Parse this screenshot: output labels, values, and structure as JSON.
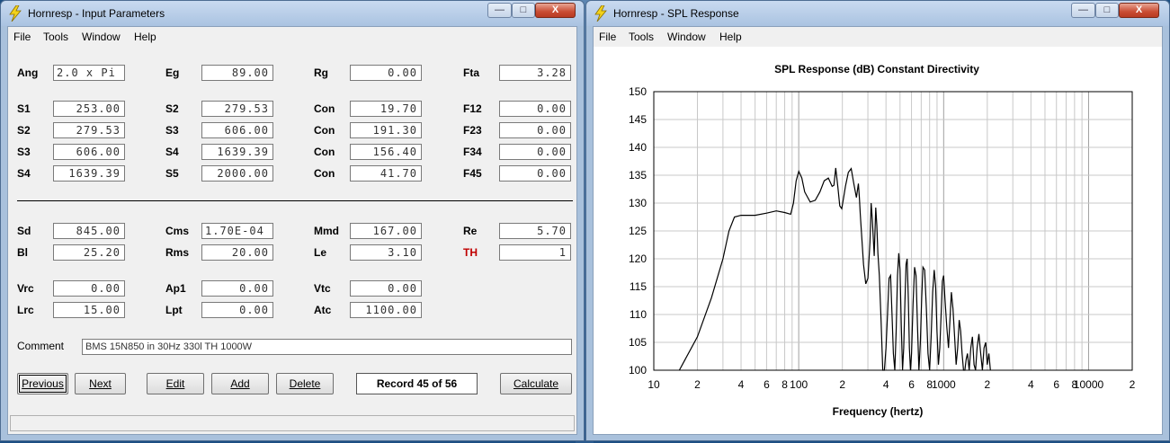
{
  "left_window": {
    "title": "Hornresp - Input Parameters",
    "menu": [
      "File",
      "Tools",
      "Window",
      "Help"
    ],
    "controls": {
      "minimize": "—",
      "maximize": "□",
      "close": "X"
    },
    "params_top": [
      {
        "l1": "Ang",
        "v1": "2.0 x Pi",
        "l2": "Eg",
        "v2": "89.00",
        "l3": "Rg",
        "v3": "0.00",
        "l4": "Fta",
        "v4": "3.28"
      }
    ],
    "params_horn": [
      {
        "l1": "S1",
        "v1": "253.00",
        "l2": "S2",
        "v2": "279.53",
        "l3": "Con",
        "v3": "19.70",
        "l4": "F12",
        "v4": "0.00"
      },
      {
        "l1": "S2",
        "v1": "279.53",
        "l2": "S3",
        "v2": "606.00",
        "l3": "Con",
        "v3": "191.30",
        "l4": "F23",
        "v4": "0.00"
      },
      {
        "l1": "S3",
        "v1": "606.00",
        "l2": "S4",
        "v2": "1639.39",
        "l3": "Con",
        "v3": "156.40",
        "l4": "F34",
        "v4": "0.00"
      },
      {
        "l1": "S4",
        "v1": "1639.39",
        "l2": "S5",
        "v2": "2000.00",
        "l3": "Con",
        "v3": "41.70",
        "l4": "F45",
        "v4": "0.00"
      }
    ],
    "params_driver": [
      {
        "l1": "Sd",
        "v1": "845.00",
        "l2": "Cms",
        "v2": "1.70E-04",
        "l3": "Mmd",
        "v3": "167.00",
        "l4": "Re",
        "v4": "5.70"
      },
      {
        "l1": "Bl",
        "v1": "25.20",
        "l2": "Rms",
        "v2": "20.00",
        "l3": "Le",
        "v3": "3.10",
        "l4": "TH",
        "v4": "1"
      }
    ],
    "params_chamber": [
      {
        "l1": "Vrc",
        "v1": "0.00",
        "l2": "Ap1",
        "v2": "0.00",
        "l3": "Vtc",
        "v3": "0.00"
      },
      {
        "l1": "Lrc",
        "v1": "15.00",
        "l2": "Lpt",
        "v2": "0.00",
        "l3": "Atc",
        "v3": "1100.00"
      }
    ],
    "comment_label": "Comment",
    "comment_value": "BMS 15N850 in 30Hz 330l TH 1000W",
    "buttons": {
      "previous": "Previous",
      "next": "Next",
      "edit": "Edit",
      "add": "Add",
      "delete": "Delete",
      "calculate": "Calculate"
    },
    "record": "Record 45 of 56",
    "th_color": "#c00000"
  },
  "right_window": {
    "title": "Hornresp - SPL Response",
    "menu": [
      "File",
      "Tools",
      "Window",
      "Help"
    ],
    "controls": {
      "minimize": "—",
      "maximize": "□",
      "close": "X"
    }
  },
  "chart_data": {
    "type": "line",
    "title": "SPL Response (dB)   Constant Directivity",
    "xlabel": "Frequency (hertz)",
    "ylabel": "",
    "x_scale": "log",
    "xlim": [
      10,
      20000
    ],
    "ylim": [
      100,
      150
    ],
    "y_ticks": [
      100,
      105,
      110,
      115,
      120,
      125,
      130,
      135,
      140,
      145,
      150
    ],
    "x_tick_labels": [
      {
        "x": 10,
        "label": "10"
      },
      {
        "x": 20,
        "label": "2"
      },
      {
        "x": 40,
        "label": "4"
      },
      {
        "x": 60,
        "label": "6"
      },
      {
        "x": 80,
        "label": "8"
      },
      {
        "x": 100,
        "label": "100"
      },
      {
        "x": 200,
        "label": "2"
      },
      {
        "x": 400,
        "label": "4"
      },
      {
        "x": 600,
        "label": "6"
      },
      {
        "x": 800,
        "label": "8"
      },
      {
        "x": 1000,
        "label": "1000"
      },
      {
        "x": 2000,
        "label": "2"
      },
      {
        "x": 4000,
        "label": "4"
      },
      {
        "x": 6000,
        "label": "6"
      },
      {
        "x": 8000,
        "label": "8"
      },
      {
        "x": 10000,
        "label": "10000"
      },
      {
        "x": 20000,
        "label": "2"
      }
    ],
    "grid": true,
    "line_color": "#000000",
    "grid_color": "#c8c8c8",
    "series": [
      {
        "points": [
          [
            15,
            100
          ],
          [
            20,
            106
          ],
          [
            25,
            113
          ],
          [
            30,
            120
          ],
          [
            33,
            125
          ],
          [
            36,
            127.5
          ],
          [
            40,
            127.8
          ],
          [
            50,
            127.8
          ],
          [
            60,
            128.2
          ],
          [
            70,
            128.6
          ],
          [
            80,
            128.3
          ],
          [
            88,
            128
          ],
          [
            92,
            130
          ],
          [
            96,
            134
          ],
          [
            100,
            135.7
          ],
          [
            105,
            134.5
          ],
          [
            110,
            132
          ],
          [
            120,
            130.2
          ],
          [
            130,
            130.5
          ],
          [
            140,
            132
          ],
          [
            150,
            134
          ],
          [
            160,
            134.5
          ],
          [
            170,
            133
          ],
          [
            175,
            133.2
          ],
          [
            180,
            136.3
          ],
          [
            186,
            133
          ],
          [
            192,
            129.5
          ],
          [
            198,
            129
          ],
          [
            204,
            131
          ],
          [
            210,
            133
          ],
          [
            220,
            135.5
          ],
          [
            230,
            136.2
          ],
          [
            240,
            133.5
          ],
          [
            250,
            131
          ],
          [
            258,
            133.5
          ],
          [
            262,
            131
          ],
          [
            266,
            128
          ],
          [
            272,
            124
          ],
          [
            280,
            119
          ],
          [
            290,
            115.5
          ],
          [
            300,
            116.5
          ],
          [
            310,
            123
          ],
          [
            316,
            130
          ],
          [
            322,
            127
          ],
          [
            328,
            123
          ],
          [
            332,
            120.5
          ],
          [
            340,
            129.2
          ],
          [
            346,
            126
          ],
          [
            352,
            121
          ],
          [
            360,
            117
          ],
          [
            370,
            109
          ],
          [
            380,
            100
          ],
          [
            390,
            100
          ],
          [
            400,
            104
          ],
          [
            410,
            110
          ],
          [
            420,
            116.5
          ],
          [
            430,
            117
          ],
          [
            440,
            110
          ],
          [
            450,
            103
          ],
          [
            460,
            100
          ],
          [
            470,
            107
          ],
          [
            480,
            117
          ],
          [
            490,
            121
          ],
          [
            500,
            118
          ],
          [
            510,
            108
          ],
          [
            520,
            100
          ],
          [
            530,
            104
          ],
          [
            540,
            112
          ],
          [
            550,
            119
          ],
          [
            560,
            120
          ],
          [
            570,
            113
          ],
          [
            580,
            104
          ],
          [
            590,
            100
          ],
          [
            600,
            103
          ],
          [
            615,
            112
          ],
          [
            630,
            118.5
          ],
          [
            645,
            117
          ],
          [
            660,
            108
          ],
          [
            675,
            100
          ],
          [
            690,
            105
          ],
          [
            705,
            113
          ],
          [
            720,
            118.5
          ],
          [
            740,
            118
          ],
          [
            760,
            111
          ],
          [
            780,
            103
          ],
          [
            800,
            100
          ],
          [
            820,
            106
          ],
          [
            840,
            114
          ],
          [
            860,
            118
          ],
          [
            880,
            115
          ],
          [
            900,
            107
          ],
          [
            920,
            101
          ],
          [
            940,
            104
          ],
          [
            960,
            110
          ],
          [
            980,
            116
          ],
          [
            1000,
            117
          ],
          [
            1020,
            113
          ],
          [
            1050,
            108
          ],
          [
            1080,
            104
          ],
          [
            1100,
            108
          ],
          [
            1130,
            114
          ],
          [
            1160,
            111
          ],
          [
            1190,
            106
          ],
          [
            1220,
            101
          ],
          [
            1250,
            104
          ],
          [
            1280,
            109
          ],
          [
            1310,
            107
          ],
          [
            1340,
            103
          ],
          [
            1370,
            100
          ],
          [
            1400,
            100
          ],
          [
            1430,
            102
          ],
          [
            1460,
            103
          ],
          [
            1500,
            100
          ],
          [
            1540,
            104
          ],
          [
            1580,
            106
          ],
          [
            1620,
            101
          ],
          [
            1660,
            100
          ],
          [
            1700,
            104
          ],
          [
            1750,
            106.5
          ],
          [
            1800,
            103
          ],
          [
            1850,
            100
          ],
          [
            1900,
            104
          ],
          [
            1950,
            105
          ],
          [
            2000,
            101
          ],
          [
            2050,
            103
          ],
          [
            2100,
            100
          ]
        ]
      }
    ]
  }
}
